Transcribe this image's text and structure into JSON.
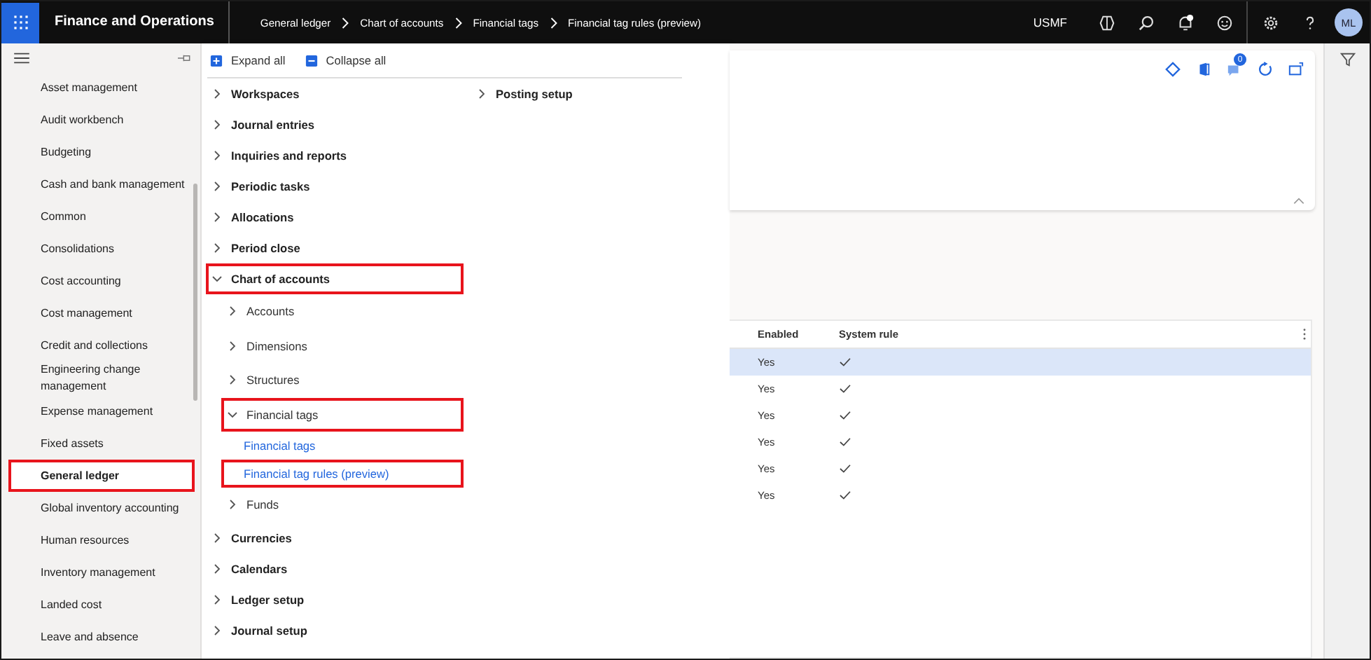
{
  "top_bar": {
    "app_title": "Finance and Operations",
    "breadcrumbs": [
      "General ledger",
      "Chart of accounts",
      "Financial tags",
      "Financial tag rules (preview)"
    ],
    "company": "USMF",
    "avatar": "ML"
  },
  "sidebar": {
    "items": [
      {
        "label": "Asset management",
        "selected": false,
        "highlighted": false
      },
      {
        "label": "Audit workbench",
        "selected": false,
        "highlighted": false
      },
      {
        "label": "Budgeting",
        "selected": false,
        "highlighted": false
      },
      {
        "label": "Cash and bank management",
        "selected": false,
        "highlighted": false
      },
      {
        "label": "Common",
        "selected": false,
        "highlighted": false
      },
      {
        "label": "Consolidations",
        "selected": false,
        "highlighted": false
      },
      {
        "label": "Cost accounting",
        "selected": false,
        "highlighted": false
      },
      {
        "label": "Cost management",
        "selected": false,
        "highlighted": false
      },
      {
        "label": "Credit and collections",
        "selected": false,
        "highlighted": false
      },
      {
        "label": "Engineering change management",
        "selected": false,
        "highlighted": false
      },
      {
        "label": "Expense management",
        "selected": false,
        "highlighted": false
      },
      {
        "label": "Fixed assets",
        "selected": false,
        "highlighted": false
      },
      {
        "label": "General ledger",
        "selected": true,
        "highlighted": true
      },
      {
        "label": "Global inventory accounting",
        "selected": false,
        "highlighted": false
      },
      {
        "label": "Human resources",
        "selected": false,
        "highlighted": false
      },
      {
        "label": "Inventory management",
        "selected": false,
        "highlighted": false
      },
      {
        "label": "Landed cost",
        "selected": false,
        "highlighted": false
      },
      {
        "label": "Leave and absence",
        "selected": false,
        "highlighted": false
      }
    ]
  },
  "menu": {
    "actions": [
      {
        "label": "Expand all",
        "kind": "expand"
      },
      {
        "label": "Collapse all",
        "kind": "collapse"
      }
    ],
    "sections": [
      {
        "items": [
          {
            "label": "Workspaces",
            "kind": "group",
            "expanded": false,
            "highlighted": false
          },
          {
            "label": "Journal entries",
            "kind": "group",
            "expanded": false,
            "highlighted": false
          },
          {
            "label": "Inquiries and reports",
            "kind": "group",
            "expanded": false,
            "highlighted": false
          },
          {
            "label": "Periodic tasks",
            "kind": "group",
            "expanded": false,
            "highlighted": false
          },
          {
            "label": "Allocations",
            "kind": "group",
            "expanded": false,
            "highlighted": false
          },
          {
            "label": "Period close",
            "kind": "group",
            "expanded": false,
            "highlighted": false
          },
          {
            "label": "Chart of accounts",
            "kind": "group",
            "expanded": true,
            "highlighted": true,
            "children": [
              {
                "label": "Accounts",
                "kind": "group",
                "expanded": false,
                "highlighted": false
              },
              {
                "label": "Dimensions",
                "kind": "group",
                "expanded": false,
                "highlighted": false
              },
              {
                "label": "Structures",
                "kind": "group",
                "expanded": false,
                "highlighted": false
              },
              {
                "label": "Financial tags",
                "kind": "group",
                "expanded": true,
                "highlighted": true,
                "children": [
                  {
                    "label": "Financial tags",
                    "kind": "link",
                    "highlighted": false
                  },
                  {
                    "label": "Financial tag rules (preview)",
                    "kind": "link",
                    "highlighted": true
                  }
                ]
              },
              {
                "label": "Funds",
                "kind": "group",
                "expanded": false,
                "highlighted": false
              }
            ]
          },
          {
            "label": "Currencies",
            "kind": "group",
            "expanded": false,
            "highlighted": false
          },
          {
            "label": "Calendars",
            "kind": "group",
            "expanded": false,
            "highlighted": false
          },
          {
            "label": "Ledger setup",
            "kind": "group",
            "expanded": false,
            "highlighted": false
          },
          {
            "label": "Journal setup",
            "kind": "group",
            "expanded": false,
            "highlighted": false
          }
        ]
      },
      {
        "items": [
          {
            "label": "Posting setup",
            "kind": "group",
            "expanded": false,
            "highlighted": false
          }
        ]
      }
    ]
  },
  "card": {
    "badge": "0"
  },
  "grid": {
    "columns": [
      "Enabled",
      "System rule"
    ],
    "rows": [
      {
        "enabled": "Yes",
        "system_rule": true,
        "selected": true
      },
      {
        "enabled": "Yes",
        "system_rule": true,
        "selected": false
      },
      {
        "enabled": "Yes",
        "system_rule": true,
        "selected": false
      },
      {
        "enabled": "Yes",
        "system_rule": true,
        "selected": false
      },
      {
        "enabled": "Yes",
        "system_rule": true,
        "selected": false
      },
      {
        "enabled": "Yes",
        "system_rule": true,
        "selected": false
      }
    ]
  }
}
